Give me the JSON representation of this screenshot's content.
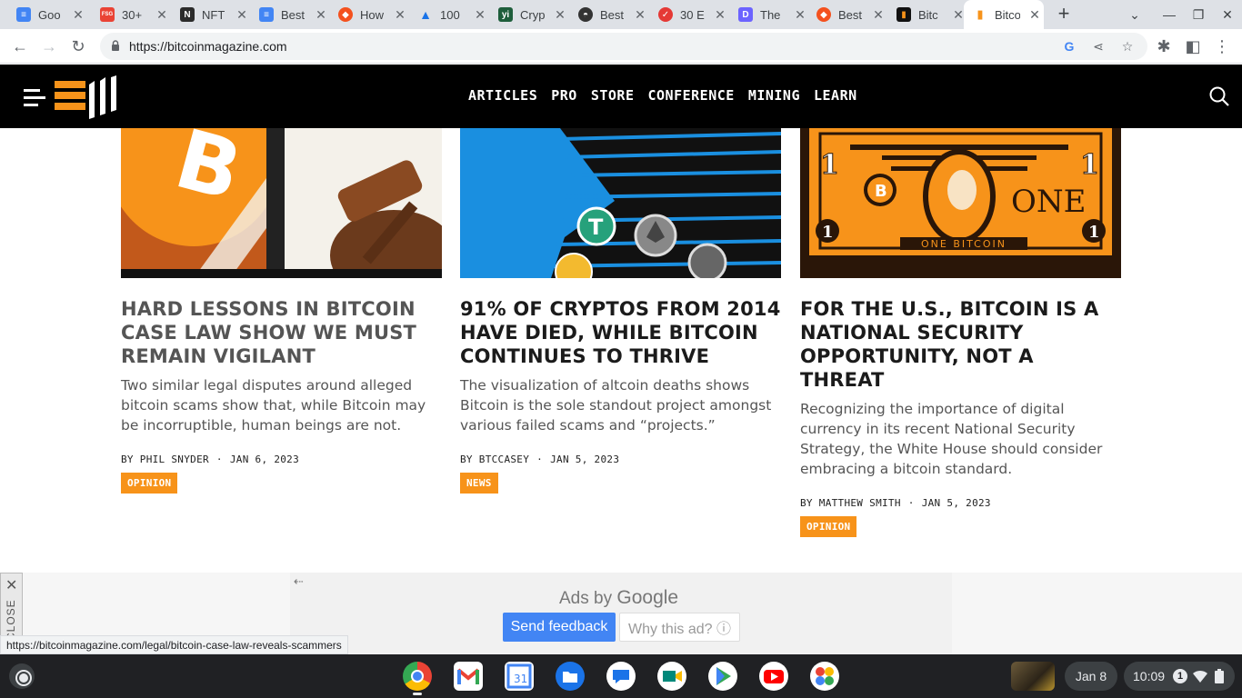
{
  "browser": {
    "tabs": [
      {
        "title": "Goo",
        "favicon": "google-docs-icon",
        "color": "#4285f4"
      },
      {
        "title": "30+",
        "favicon": "fsg-icon",
        "color": "#ea4335"
      },
      {
        "title": "NFT",
        "favicon": "notion-icon",
        "color": "#2b2b2b"
      },
      {
        "title": "Best",
        "favicon": "google-docs-icon",
        "color": "#4285f4"
      },
      {
        "title": "How",
        "favicon": "flame-icon",
        "color": "#f4511e"
      },
      {
        "title": "100",
        "favicon": "analytics-icon",
        "color": "#1a73e8"
      },
      {
        "title": "Cryp",
        "favicon": "yi-icon",
        "color": "#1e5e3b"
      },
      {
        "title": "Best",
        "favicon": "hat-icon",
        "color": "#333333"
      },
      {
        "title": "30 E",
        "favicon": "checkmark-icon",
        "color": "#e53935"
      },
      {
        "title": "The",
        "favicon": "d-icon",
        "color": "#6c63ff"
      },
      {
        "title": "Best",
        "favicon": "flame-icon",
        "color": "#f4511e"
      },
      {
        "title": "Bitc",
        "favicon": "bitcoin-magazine-icon",
        "color": "#f7931a"
      },
      {
        "title": "Bitco",
        "favicon": "bitcoin-magazine-icon",
        "color": "#f7931a"
      }
    ],
    "url": "https://bitcoinmagazine.com",
    "status_url": "https://bitcoinmagazine.com/legal/bitcoin-case-law-reveals-scammers"
  },
  "site": {
    "nav": [
      "ARTICLES",
      "PRO",
      "STORE",
      "CONFERENCE",
      "MINING",
      "LEARN"
    ],
    "brand_color": "#f7931a"
  },
  "articles": [
    {
      "title": "HARD LESSONS IN BITCOIN CASE LAW SHOW WE MUST REMAIN VIGILANT",
      "excerpt": "Two similar legal disputes around alleged bitcoin scams show that, while Bitcoin may be incorruptible, human beings are not.",
      "author": "BY PHIL SNYDER",
      "date": "JAN 6, 2023",
      "category": "OPINION"
    },
    {
      "title": "91% OF CRYPTOS FROM 2014 HAVE DIED, WHILE BITCOIN CONTINUES TO THRIVE",
      "excerpt": "The visualization of altcoin deaths shows Bitcoin is the sole standout project amongst various failed scams and “projects.”",
      "author": "BY BTCCASEY",
      "date": "JAN 5, 2023",
      "category": "NEWS"
    },
    {
      "title": "FOR THE U.S., BITCOIN IS A NATIONAL SECURITY OPPORTUNITY, NOT A THREAT",
      "excerpt": "Recognizing the importance of digital currency in its recent National Security Strategy, the White House should consider embracing a bitcoin standard.",
      "author": "BY MATTHEW SMITH",
      "date": "JAN 5, 2023",
      "category": "OPINION"
    }
  ],
  "ad": {
    "ads_by": "Ads by",
    "google": "Google",
    "feedback": "Send feedback",
    "why": "Why this ad? ⓘ",
    "close": "CLOSE"
  },
  "shelf": {
    "apps": [
      "chrome-icon",
      "gmail-icon",
      "calendar-icon",
      "files-icon",
      "messages-icon",
      "meet-icon",
      "play-store-icon",
      "youtube-icon",
      "photos-icon"
    ],
    "date": "Jan 8",
    "time": "10:09",
    "notifications": "1"
  }
}
